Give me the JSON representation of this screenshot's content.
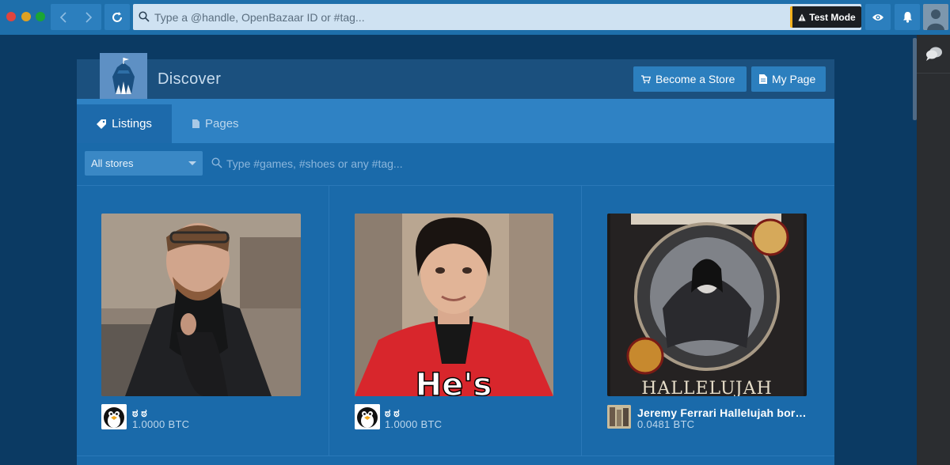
{
  "topbar": {
    "address_placeholder": "Type a @handle, OpenBazaar ID or #tag...",
    "test_mode_label": "Test Mode"
  },
  "header": {
    "title": "Discover",
    "become_store_label": "Become a Store",
    "my_page_label": "My Page"
  },
  "tabs": [
    {
      "label": "Listings",
      "active": true
    },
    {
      "label": "Pages",
      "active": false
    }
  ],
  "filter": {
    "store_select": "All stores",
    "tag_placeholder": "Type #games, #shoes or any #tag..."
  },
  "listings": [
    {
      "title": "ಠ ಠ",
      "price": "1.0000 BTC"
    },
    {
      "title": "ಠ ಠ",
      "price": "1.0000 BTC"
    },
    {
      "title": "Jeremy Ferrari Hallelujah bor…",
      "price": "0.0481 BTC"
    }
  ],
  "images": {
    "listing_3_cover_lettering": "HALLELUJAH",
    "listing_2_caption": "He's"
  },
  "colors": {
    "accent": "#2c7fbe",
    "header": "#1b507e",
    "test_mode_stripe": "#f5b01a"
  }
}
